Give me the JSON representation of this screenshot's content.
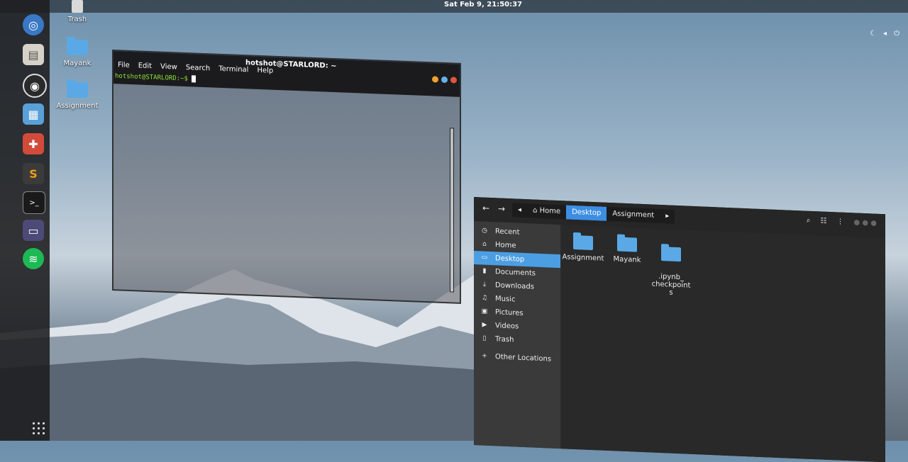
{
  "topbar": {
    "clock": "Sat Feb  9, 21:50:37",
    "tray_icons": [
      "moon-icon",
      "volume-icon",
      "power-icon"
    ]
  },
  "dock": {
    "apps": [
      {
        "name": "chromium-icon",
        "color": "#3a78c5",
        "glyph": "◎"
      },
      {
        "name": "files-icon",
        "color": "#d7d2c8",
        "glyph": "▤"
      },
      {
        "name": "rhythmbox-icon",
        "color": "#2a2a2a",
        "glyph": "◉"
      },
      {
        "name": "libreoffice-writer-icon",
        "color": "#5aa0d8",
        "glyph": "▦"
      },
      {
        "name": "software-center-icon",
        "color": "#d24b3a",
        "glyph": "✚"
      },
      {
        "name": "sublime-text-icon",
        "color": "#3b3b3b",
        "glyph": "S"
      },
      {
        "name": "terminal-icon",
        "color": "#1a1a1a",
        "glyph": ">_"
      },
      {
        "name": "screen-icon",
        "color": "#4d4a78",
        "glyph": "▭"
      },
      {
        "name": "spotify-icon",
        "color": "#1db954",
        "glyph": "≋"
      }
    ]
  },
  "desktop": {
    "trash": "Trash",
    "folders": [
      "Mayank",
      "Assignment"
    ]
  },
  "terminal": {
    "title": "hotshot@STARLORD: ~",
    "menu": [
      "File",
      "Edit",
      "View",
      "Search",
      "Terminal",
      "Help"
    ],
    "prompt": "hotshot@STARLORD:~$"
  },
  "files": {
    "breadcrumb": [
      "Home",
      "Desktop",
      "Assignment"
    ],
    "sidebar": [
      "Recent",
      "Home",
      "Desktop",
      "Documents",
      "Downloads",
      "Music",
      "Pictures",
      "Videos",
      "Trash",
      "Other Locations"
    ],
    "items": [
      "Assignment",
      "Mayank",
      ".ipynb_\ncheckpoint\ns"
    ]
  }
}
